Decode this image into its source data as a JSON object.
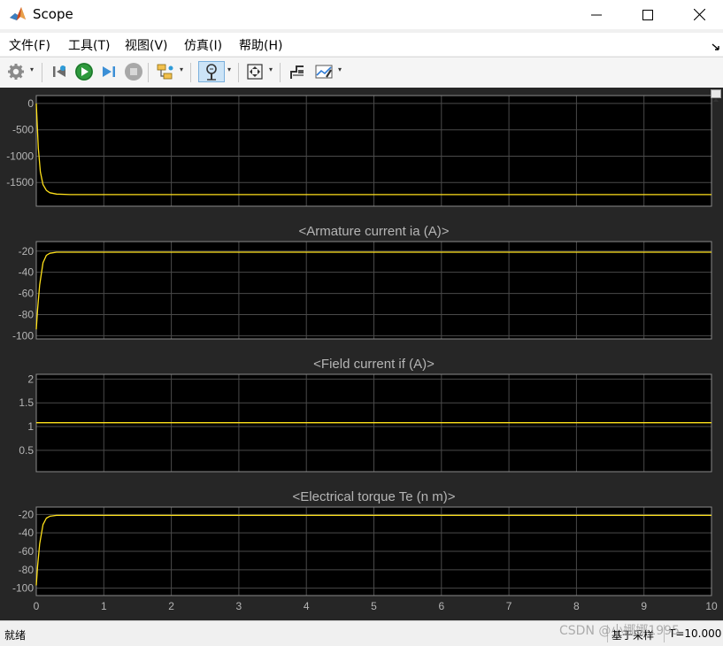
{
  "window": {
    "title": "Scope",
    "controls": {
      "minimize": "minimize",
      "maximize": "maximize",
      "close": "close"
    }
  },
  "menu": {
    "items": [
      "文件(F)",
      "工具(T)",
      "视图(V)",
      "仿真(I)",
      "帮助(H)"
    ],
    "pin_icon": "pin-icon"
  },
  "toolbar": {
    "icons": [
      "gear-icon",
      "step-back-icon",
      "run-icon",
      "step-forward-icon",
      "stop-icon",
      "highlight-block-icon",
      "zoom-icon",
      "fit-to-view-icon",
      "cursor-measure-icon",
      "triggers-icon"
    ]
  },
  "colors": {
    "plot_background": "#000000",
    "figure_background": "#262626",
    "grid": "#4a4a4a",
    "axes_text": "#b5b5b5",
    "signal": "#ffe11a"
  },
  "chart_data": [
    {
      "type": "line",
      "title": "",
      "xlabel": "",
      "ylabel": "",
      "xlim": [
        0,
        10
      ],
      "ylim": [
        -1950,
        150
      ],
      "yticks": [
        0,
        -500,
        -1000,
        -1500
      ],
      "ytick_labels": [
        "0",
        "-500",
        "-1000",
        "-1500"
      ],
      "xtick_labels": [],
      "grid": true,
      "series": [
        {
          "x": [
            0,
            0.03,
            0.06,
            0.1,
            0.15,
            0.2,
            0.3,
            0.5,
            1,
            10
          ],
          "values": [
            0,
            -850,
            -1300,
            -1540,
            -1650,
            -1695,
            -1720,
            -1730,
            -1730,
            -1730
          ]
        }
      ]
    },
    {
      "type": "line",
      "title": "<Armature current ia (A)>",
      "xlabel": "",
      "ylabel": "",
      "xlim": [
        0,
        10
      ],
      "ylim": [
        -103,
        -11
      ],
      "yticks": [
        -20,
        -40,
        -60,
        -80,
        -100
      ],
      "ytick_labels": [
        "-20",
        "-40",
        "-60",
        "-80",
        "-100"
      ],
      "xtick_labels": [],
      "grid": true,
      "series": [
        {
          "x": [
            0,
            0.02,
            0.05,
            0.1,
            0.15,
            0.2,
            0.3,
            0.5,
            10
          ],
          "values": [
            -94,
            -75,
            -52,
            -31,
            -24,
            -22,
            -21,
            -21,
            -21
          ]
        }
      ]
    },
    {
      "type": "line",
      "title": "<Field current if (A)>",
      "xlabel": "",
      "ylabel": "",
      "xlim": [
        0,
        10
      ],
      "ylim": [
        0.05,
        2.1
      ],
      "yticks": [
        2,
        1.5,
        1,
        0.5
      ],
      "ytick_labels": [
        "2",
        "1.5",
        "1",
        "0.5"
      ],
      "xtick_labels": [],
      "grid": true,
      "series": [
        {
          "x": [
            0,
            10
          ],
          "values": [
            1.08,
            1.08
          ]
        }
      ]
    },
    {
      "type": "line",
      "title": "<Electrical torque Te (n m)>",
      "xlabel": "",
      "ylabel": "",
      "xlim": [
        0,
        10
      ],
      "ylim": [
        -108,
        -12
      ],
      "yticks": [
        -20,
        -40,
        -60,
        -80,
        -100
      ],
      "ytick_labels": [
        "-20",
        "-40",
        "-60",
        "-80",
        "-100"
      ],
      "xtick_labels": [
        "0",
        "1",
        "2",
        "3",
        "4",
        "5",
        "6",
        "7",
        "8",
        "9",
        "10"
      ],
      "grid": true,
      "series": [
        {
          "x": [
            0,
            0.02,
            0.05,
            0.1,
            0.15,
            0.2,
            0.3,
            0.5,
            10
          ],
          "values": [
            -97,
            -76,
            -52,
            -31,
            -24,
            -22,
            -21,
            -21,
            -21
          ]
        }
      ]
    }
  ],
  "status": {
    "left": "就绪",
    "mid": "基于采样",
    "right": "T=10.000"
  },
  "watermark": "CSDN @小娜娜1995"
}
